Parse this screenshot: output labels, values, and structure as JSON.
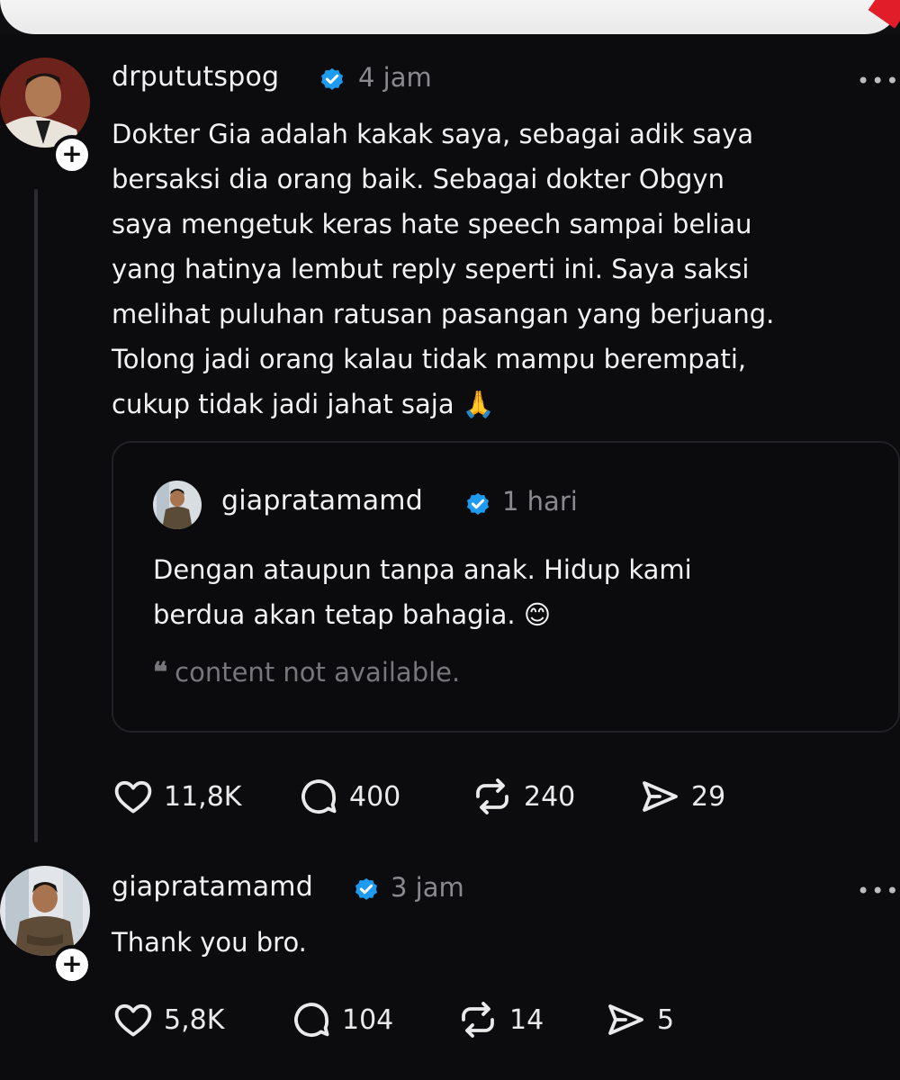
{
  "post": {
    "username": "drpututspog",
    "time": "4 jam",
    "more": "•••",
    "follow": "+",
    "lines": [
      "Dokter Gia adalah kakak saya, sebagai adik saya",
      "bersaksi dia orang baik. Sebagai dokter Obgyn",
      "saya mengetuk keras hate speech sampai beliau",
      "yang hatinya lembut reply seperti ini. Saya saksi",
      "melihat puluhan ratusan pasangan yang berjuang.",
      "Tolong jadi orang kalau tidak mampu berempati,",
      "cukup tidak jadi jahat saja 🙏"
    ],
    "quote": {
      "username": "giapratamamd",
      "time": "1 hari",
      "lines": [
        "Dengan ataupun tanpa anak.  Hidup kami",
        "berdua akan tetap bahagia. 😊"
      ],
      "not_available": "content not available."
    },
    "stats": {
      "likes": "11,8K",
      "replies": "400",
      "reposts": "240",
      "shares": "29"
    }
  },
  "reply": {
    "username": "giapratamamd",
    "time": "3 jam",
    "more": "•••",
    "follow": "+",
    "text": "Thank you bro.",
    "stats": {
      "likes": "5,8K",
      "replies": "104",
      "reposts": "14",
      "shares": "5"
    }
  },
  "colors": {
    "verified": "#1d9bf0",
    "background": "#0c0c0e",
    "muted": "#8a8a8e"
  }
}
